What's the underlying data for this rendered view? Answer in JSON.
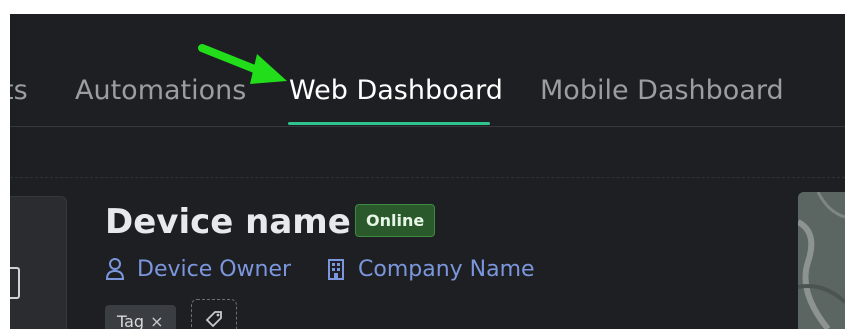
{
  "tabs": [
    {
      "label": "ts",
      "active": false
    },
    {
      "label": "Automations",
      "active": false
    },
    {
      "label": "Web Dashboard",
      "active": true
    },
    {
      "label": "Mobile Dashboard",
      "active": false
    }
  ],
  "device": {
    "name": "Device name",
    "status": "Online",
    "owner": "Device Owner",
    "company": "Company Name",
    "tags": [
      {
        "label": "Tag",
        "remove_symbol": "×"
      }
    ]
  },
  "colors": {
    "background": "#1d1f22",
    "accent_underline": "#2fc48d",
    "status_badge": "#2a5a2c",
    "link": "#7b96dc",
    "annotation_arrow": "#22dd1a"
  },
  "icons": {
    "owner": "user-icon",
    "company": "building-icon",
    "add_tag": "tag-icon",
    "annotation": "arrow-annotation"
  }
}
